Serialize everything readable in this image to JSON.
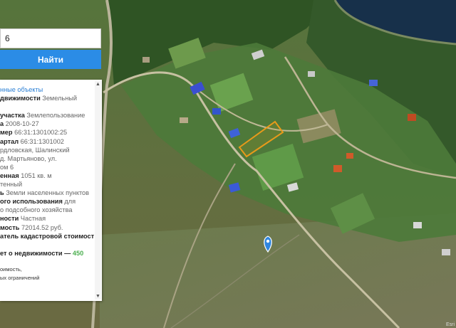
{
  "search": {
    "value": "6",
    "button_label": "Найти"
  },
  "panel": {
    "header": "нные объекты",
    "rows": [
      {
        "label": "движимости",
        "value": " Земельный"
      },
      {
        "label": "",
        "value": ""
      },
      {
        "label": "участка",
        "value": " Землепользование"
      },
      {
        "label": "а",
        "value": " 2008-10-27"
      },
      {
        "label": "мер",
        "value": " 66:31:1301002:25"
      },
      {
        "label": "артал",
        "value": " 66:31:1301002"
      },
      {
        "label": "",
        "value": "рдловская, Шалинский"
      },
      {
        "label": "",
        "value": " д. Мартьяново, ул."
      },
      {
        "label": "",
        "value": "ом 6"
      },
      {
        "label": "енная",
        "value": " 1051 кв. м"
      },
      {
        "label": "",
        "value": "тенный"
      },
      {
        "label": "ь",
        "value": " Земли населенных пунктов"
      },
      {
        "label": "ого использования",
        "value": " для"
      },
      {
        "label": "",
        "value": "о подсобного хозяйства"
      },
      {
        "label": "ности",
        "value": " Частная"
      },
      {
        "label": "мость",
        "value": " 72014.52 руб."
      },
      {
        "label": "атель кадастровой стоимости",
        "value": ""
      }
    ],
    "report_label": "ет о недвижимости —",
    "report_price": "450",
    "footnote_1": "оимость,",
    "footnote_2": "ых ограничений"
  },
  "scroll": {
    "up": "▲",
    "down": "▼"
  },
  "map_copyright": "Esri",
  "colors": {
    "button": "#2b8ce6",
    "parcel": "#e89a1a",
    "marker": "#2f86e0",
    "link": "#2a7fd4",
    "price": "#4caf50"
  }
}
